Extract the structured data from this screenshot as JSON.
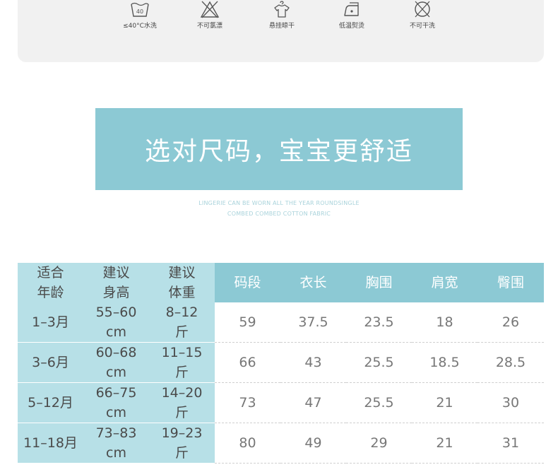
{
  "care": [
    {
      "icon": "wash-40-icon",
      "label": "≤40°C水洗"
    },
    {
      "icon": "no-bleach-icon",
      "label": "不可氯漂"
    },
    {
      "icon": "hang-dry-icon",
      "label": "悬挂晾干"
    },
    {
      "icon": "low-iron-icon",
      "label": "低温熨烫"
    },
    {
      "icon": "no-dry-clean-icon",
      "label": "不可干洗"
    }
  ],
  "wash_temp": "40",
  "banner": {
    "title": "选对尺码，宝宝更舒适"
  },
  "subtitle": {
    "line1": "LINGERIE CAN BE WORN ALL THE YEAR ROUNDSINGLE",
    "line2": "COMBED COMBED COTTON FABRIC"
  },
  "table": {
    "headers_left": [
      [
        "适合",
        "年龄"
      ],
      [
        "建议",
        "身高"
      ],
      [
        "建议",
        "体重"
      ]
    ],
    "headers_right": [
      "码段",
      "衣长",
      "胸围",
      "肩宽",
      "臀围"
    ],
    "rows": [
      {
        "age": "1–3月",
        "height": [
          "55–60",
          "cm"
        ],
        "weight": [
          "8–12",
          "斤"
        ],
        "values": [
          "59",
          "37.5",
          "23.5",
          "18",
          "26"
        ]
      },
      {
        "age": "3–6月",
        "height": [
          "60–68",
          "cm"
        ],
        "weight": [
          "11–15",
          "斤"
        ],
        "values": [
          "66",
          "43",
          "25.5",
          "18.5",
          "28.5"
        ]
      },
      {
        "age": "5–12月",
        "height": [
          "66–75",
          "cm"
        ],
        "weight": [
          "14–20",
          "斤"
        ],
        "values": [
          "73",
          "47",
          "25.5",
          "21",
          "30"
        ]
      },
      {
        "age": "11–18月",
        "height": [
          "73–83",
          "cm"
        ],
        "weight": [
          "19–23",
          "斤"
        ],
        "values": [
          "80",
          "49",
          "29",
          "21",
          "31"
        ]
      }
    ]
  },
  "colors": {
    "accent": "#8cc9d4",
    "accent_light": "#b7e0e7",
    "panel": "#f1f1f1"
  }
}
